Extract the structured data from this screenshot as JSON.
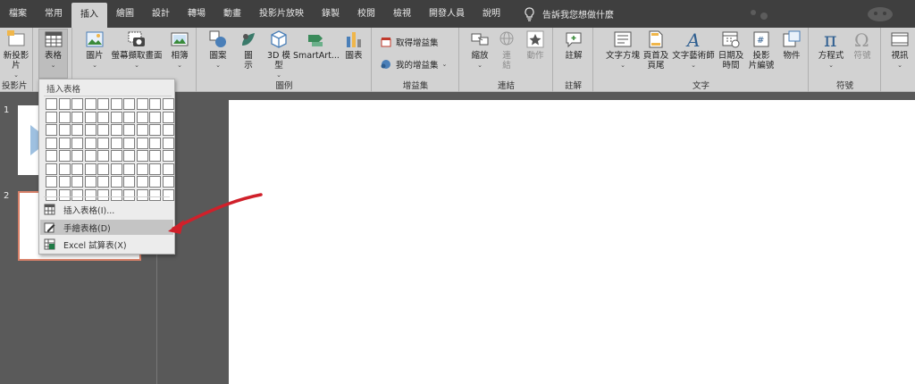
{
  "tabs": [
    {
      "label": "檔案",
      "active": false
    },
    {
      "label": "常用",
      "active": false
    },
    {
      "label": "插入",
      "active": true
    },
    {
      "label": "繪圖",
      "active": false
    },
    {
      "label": "設計",
      "active": false
    },
    {
      "label": "轉場",
      "active": false
    },
    {
      "label": "動畫",
      "active": false
    },
    {
      "label": "投影片放映",
      "active": false
    },
    {
      "label": "錄製",
      "active": false
    },
    {
      "label": "校閱",
      "active": false
    },
    {
      "label": "檢視",
      "active": false
    },
    {
      "label": "開發人員",
      "active": false
    },
    {
      "label": "說明",
      "active": false
    }
  ],
  "tell_me": "告訴我您想做什麼",
  "ribbon": {
    "slides": {
      "new_slide_l1": "新投影",
      "new_slide_l2": "片",
      "group": "投影片"
    },
    "tables": {
      "table_label": "表格"
    },
    "images": {
      "picture": "圖片",
      "screenshot": "螢幕擷取畫面",
      "album": "相簿"
    },
    "illustrations": {
      "shapes": "圖案",
      "icons_l1": "圖",
      "icons_l2": "示",
      "models_l1": "3D 模",
      "models_l2": "型",
      "smartart": "SmartArt...",
      "chart": "圖表",
      "group": "圖例"
    },
    "addins": {
      "get": "取得增益集",
      "mine": "我的增益集",
      "group": "增益集"
    },
    "links": {
      "zoom": "縮放",
      "link_l1": "連",
      "link_l2": "結",
      "action": "動作",
      "group": "連結"
    },
    "comments": {
      "comment": "註解",
      "group": "註解"
    },
    "text": {
      "textbox": "文字方塊",
      "header_l1": "頁首及",
      "header_l2": "頁尾",
      "wordart": "文字藝術師",
      "date_l1": "日期及",
      "date_l2": "時間",
      "slidenum_l1": "投影",
      "slidenum_l2": "片編號",
      "object": "物件",
      "group": "文字"
    },
    "symbols": {
      "equation": "方程式",
      "symbol": "符號",
      "group": "符號"
    },
    "media": {
      "video": "視訊"
    }
  },
  "slides": [
    {
      "number": "1"
    },
    {
      "number": "2"
    }
  ],
  "dropdown": {
    "title": "插入表格",
    "items": [
      {
        "label": "插入表格(I)...",
        "highlighted": false
      },
      {
        "label": "手繪表格(D)",
        "highlighted": true
      },
      {
        "label": "Excel 試算表(X)",
        "highlighted": false
      }
    ]
  },
  "colors": {
    "ribbon_bg": "#d2d2d2",
    "tabbar_bg": "#3f3f3f",
    "annotation_arrow": "#d0202a",
    "selected_slide_border": "#d9826a"
  }
}
